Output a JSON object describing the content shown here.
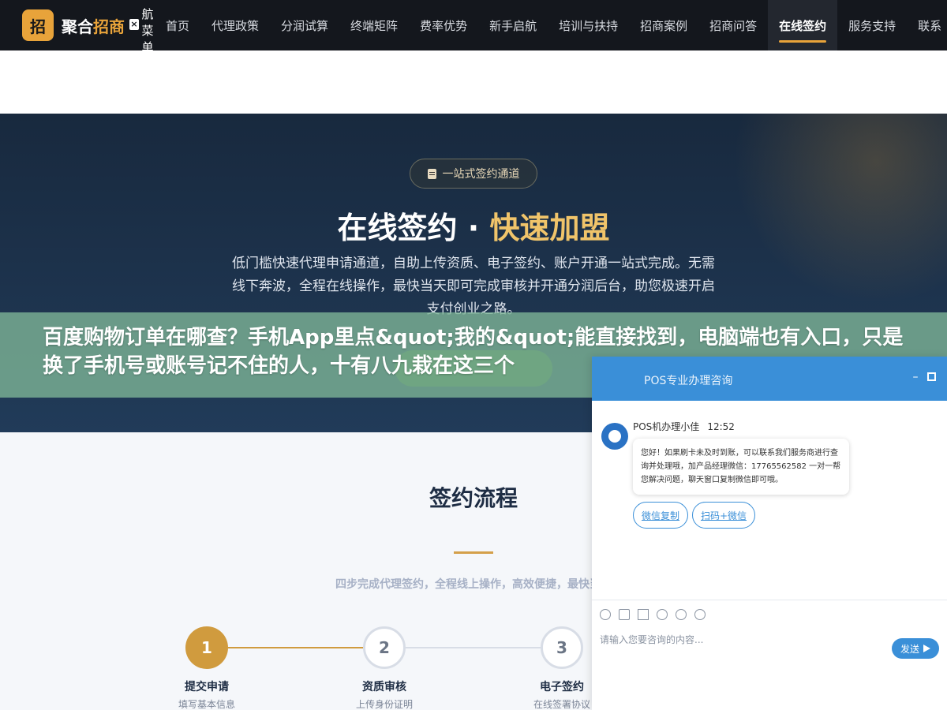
{
  "nav": {
    "logo_badge": "招",
    "logo_text_a": "聚合",
    "logo_text_b": "招商",
    "close_label": "×",
    "menu_label": "航菜单",
    "items": [
      {
        "label": "首页"
      },
      {
        "label": "代理政策"
      },
      {
        "label": "分润试算"
      },
      {
        "label": "终端矩阵"
      },
      {
        "label": "费率优势"
      },
      {
        "label": "新手启航"
      },
      {
        "label": "培训与扶持"
      },
      {
        "label": "招商案例"
      },
      {
        "label": "招商问答"
      },
      {
        "label": "在线签约",
        "active": true
      },
      {
        "label": "服务支持"
      },
      {
        "label": "联系"
      }
    ]
  },
  "hero": {
    "pill": "一站式签约通道",
    "title_a": "在线签约 · ",
    "title_b": "快速加盟",
    "desc": "低门槛快速代理申请通道，自助上传资质、电子签约、账户开通一站式完成。无需线下奔波，全程在线操作，最快当天即可完成审核并开通分润后台，助您极速开启支付创业之路。"
  },
  "overlay": {
    "text": "百度购物订单在哪查？手机App里点&quot;我的&quot;能直接找到，电脑端也有入口，只是换了手机号或账号记不住的人，十有八九栽在这三个"
  },
  "process": {
    "title": "签约流程",
    "subtitle": "四步完成代理签约，全程线上操作，高效便捷，最快当天",
    "steps": [
      {
        "num": "1",
        "name": "提交申请",
        "desc": "填写基本信息"
      },
      {
        "num": "2",
        "name": "资质审核",
        "desc": "上传身份证明"
      },
      {
        "num": "3",
        "name": "电子签约",
        "desc": "在线签署协议"
      }
    ]
  },
  "chat": {
    "header_title": "POS专业办理咨询",
    "agent_name": "POS机办理小佳",
    "time": "12:52",
    "message": "您好！如果刷卡未及时到账，可以联系我们服务商进行查询并处理哦，加产品经理微信：17765562582 一对一帮您解决问题，聊天窗口复制微信即可哦。",
    "quick_1": "微信复制",
    "quick_2": "扫码+微信",
    "input_placeholder": "请输入您要咨询的内容...",
    "send_label": "发送"
  },
  "colors": {
    "nav_bg": "#14171d",
    "accent_gold": "#e8a33a",
    "hero_bg": "#1d3450",
    "chat_blue": "#3a8fd8"
  }
}
